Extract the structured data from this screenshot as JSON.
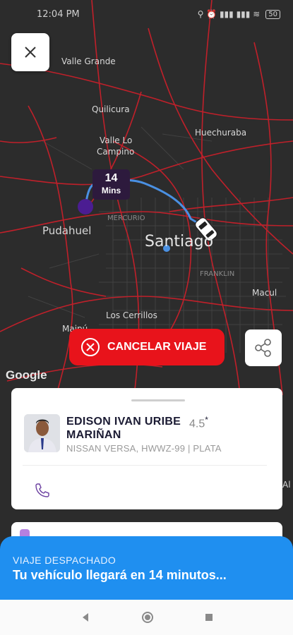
{
  "status_bar": {
    "time": "12:04 PM",
    "icons_right": "⚲ ⏰ ▮▮▮ ▮▮▮ ≋",
    "battery": "50"
  },
  "map": {
    "labels": [
      "Valle Grande",
      "Quilicura",
      "Valle Lo",
      "Campino",
      "Huechuraba",
      "Pudahuel",
      "MERCURIO",
      "Santiago",
      "FRANKLIN",
      "Macul",
      "Los Cerrillos",
      "Maipú",
      "Al"
    ],
    "eta_number": "14",
    "eta_unit": "Mins",
    "google_logo": "Google"
  },
  "actions": {
    "cancel_label": "CANCELAR VIAJE"
  },
  "driver": {
    "name": "EDISON IVAN URIBE MARIÑAN",
    "rating": "4.5",
    "rating_star": "*",
    "vehicle": "NISSAN VERSA, HWWZ-99 | PLATA"
  },
  "banner": {
    "status": "VIAJE DESPACHADO",
    "message": "Tu vehículo llegará en 14 minutos..."
  },
  "colors": {
    "cancel": "#e8131b",
    "banner": "#1f8ff0",
    "route": "#4a90e2",
    "origin": "#5b21b6",
    "roads": "#c0202a"
  },
  "icons": {
    "close": "close-icon",
    "share": "share-icon",
    "phone": "phone-icon",
    "cancel": "cancel-circle-icon",
    "car": "car-icon"
  }
}
